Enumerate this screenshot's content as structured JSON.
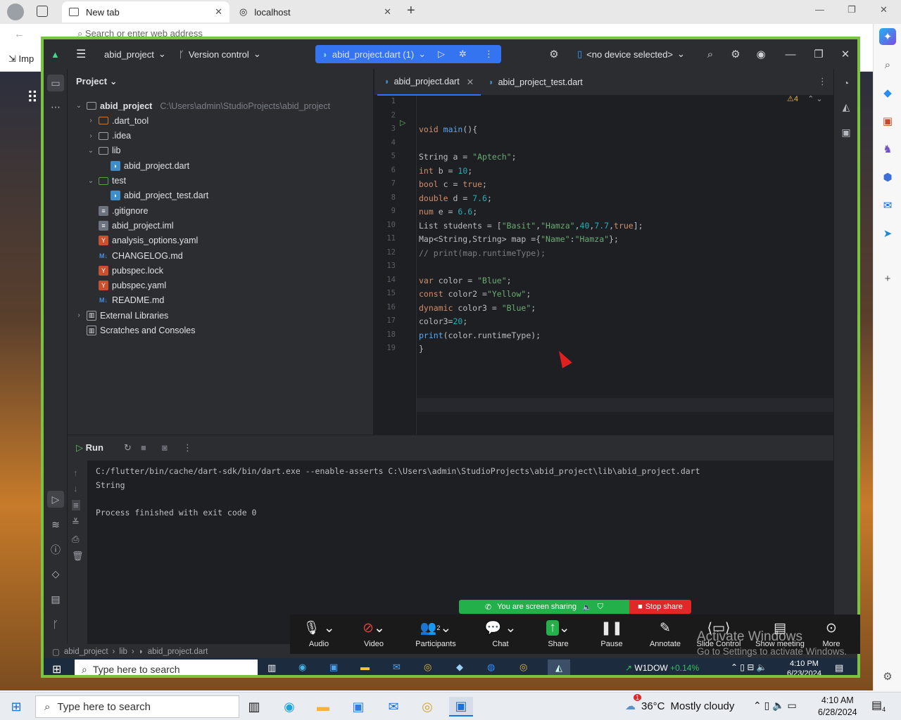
{
  "browser": {
    "tabs": [
      {
        "label": "New tab",
        "active": true
      },
      {
        "label": "localhost",
        "active": false
      }
    ],
    "address_placeholder": "Search or enter web address",
    "bookmark_label": "Imp"
  },
  "ide": {
    "project_name": "abid_project",
    "vcs_label": "Version control",
    "run_config": "abid_project.dart (1)",
    "device_selector": "<no device selected>",
    "project_panel_title": "Project",
    "tree": [
      {
        "label": "abid_project",
        "path": "C:\\Users\\admin\\StudioProjects\\abid_project",
        "indent": 0,
        "arrow": "v",
        "icon": "folder",
        "bold": true
      },
      {
        "label": ".dart_tool",
        "indent": 1,
        "arrow": ">",
        "icon": "folder-orange"
      },
      {
        "label": ".idea",
        "indent": 1,
        "arrow": ">",
        "icon": "folder"
      },
      {
        "label": "lib",
        "indent": 1,
        "arrow": "v",
        "icon": "folder"
      },
      {
        "label": "abid_project.dart",
        "indent": 2,
        "arrow": "",
        "icon": "dart"
      },
      {
        "label": "test",
        "indent": 1,
        "arrow": "v",
        "icon": "folder-green"
      },
      {
        "label": "abid_project_test.dart",
        "indent": 2,
        "arrow": "",
        "icon": "dart"
      },
      {
        "label": ".gitignore",
        "indent": 1,
        "arrow": "",
        "icon": "file"
      },
      {
        "label": "abid_project.iml",
        "indent": 1,
        "arrow": "",
        "icon": "file"
      },
      {
        "label": "analysis_options.yaml",
        "indent": 1,
        "arrow": "",
        "icon": "yaml"
      },
      {
        "label": "CHANGELOG.md",
        "indent": 1,
        "arrow": "",
        "icon": "md"
      },
      {
        "label": "pubspec.lock",
        "indent": 1,
        "arrow": "",
        "icon": "yaml"
      },
      {
        "label": "pubspec.yaml",
        "indent": 1,
        "arrow": "",
        "icon": "yaml"
      },
      {
        "label": "README.md",
        "indent": 1,
        "arrow": "",
        "icon": "md"
      },
      {
        "label": "External Libraries",
        "indent": 0,
        "arrow": ">",
        "icon": "lib"
      },
      {
        "label": "Scratches and Consoles",
        "indent": 0,
        "arrow": "",
        "icon": "lib"
      }
    ],
    "editor_tabs": [
      {
        "label": "abid_project.dart",
        "active": true
      },
      {
        "label": "abid_project_test.dart",
        "active": false
      }
    ],
    "inspection_count": "4",
    "code_lines": [
      {
        "n": "1",
        "html": ""
      },
      {
        "n": "2",
        "html": ""
      },
      {
        "n": "3",
        "html": "<span class='tk-kw'>void</span> <span class='tk-fn'>main</span>(){"
      },
      {
        "n": "4",
        "html": ""
      },
      {
        "n": "5",
        "html": "String a = <span class='tk-str'>\"Aptech\"</span>;"
      },
      {
        "n": "6",
        "html": "<span class='tk-kw'>int</span> b = <span class='tk-num'>10</span>;"
      },
      {
        "n": "7",
        "html": "<span class='tk-kw'>bool</span> c = <span class='tk-kw'>true</span>;"
      },
      {
        "n": "8",
        "html": "<span class='tk-kw'>double</span> d = <span class='tk-num'>7.6</span>;"
      },
      {
        "n": "9",
        "html": "<span class='tk-kw'>num</span> e = <span class='tk-num'>6.6</span>;"
      },
      {
        "n": "10",
        "html": "List students = [<span class='tk-str'>\"Basit\"</span>,<span class='tk-str'>\"Hamza\"</span>,<span class='tk-num'>40</span>,<span class='tk-num'>7.7</span>,<span class='tk-kw'>true</span>];"
      },
      {
        "n": "11",
        "html": "Map&lt;String,String&gt; map ={<span class='tk-str'>\"Name\"</span>:<span class='tk-str'>\"Hamza\"</span>};"
      },
      {
        "n": "12",
        "html": "<span class='tk-cm'>// print(map.runtimeType);</span>"
      },
      {
        "n": "13",
        "html": ""
      },
      {
        "n": "14",
        "html": "<span class='tk-kw'>var</span> color = <span class='tk-str'>\"Blue\"</span>;"
      },
      {
        "n": "15",
        "html": "<span class='tk-kw'>const</span> color2 =<span class='tk-str'>\"Yellow\"</span>;"
      },
      {
        "n": "16",
        "html": "<span class='tk-kw'>dynamic</span> color3 = <span class='tk-str'>\"Blue\"</span>;"
      },
      {
        "n": "17",
        "html": "color3=<span class='tk-num'>20</span>;"
      },
      {
        "n": "18",
        "html": "<span class='tk-fn'>print</span>(color.runtimeType);"
      },
      {
        "n": "19",
        "html": "}"
      }
    ],
    "run_title": "Run",
    "console": [
      "C:/flutter/bin/cache/dart-sdk/bin/dart.exe --enable-asserts C:\\Users\\admin\\StudioProjects\\abid_project\\lib\\abid_project.dart",
      "String",
      "",
      "Process finished with exit code 0"
    ],
    "breadcrumb": [
      "abid_project",
      "lib",
      "abid_project.dart"
    ]
  },
  "inner_taskbar": {
    "search_placeholder": "Type here to search",
    "stock_label": "W1DOW",
    "stock_change": "+0.14%",
    "time": "4:10 PM",
    "date": "6/23/2024"
  },
  "zoom": {
    "sharing_text": "You are screen sharing",
    "stop_label": "Stop share",
    "buttons": [
      "Audio",
      "Video",
      "Participants",
      "Chat",
      "Share",
      "Pause",
      "Annotate",
      "Slide Control",
      "Show meeting",
      "More"
    ],
    "participants_count": "2"
  },
  "watermark": {
    "title": "Activate Windows",
    "subtitle": "Go to Settings to activate Windows."
  },
  "taskbar": {
    "search_placeholder": "Type here to search",
    "weather_temp": "36°C",
    "weather_desc": "Mostly cloudy",
    "weather_badge": "1",
    "time": "4:10 AM",
    "date": "6/28/2024",
    "notification_count": "4"
  },
  "colors": {
    "ide_border": "#7cc242",
    "run_config_bg": "#3574f0",
    "zoom_green": "#23b04a",
    "zoom_red": "#e02828"
  }
}
